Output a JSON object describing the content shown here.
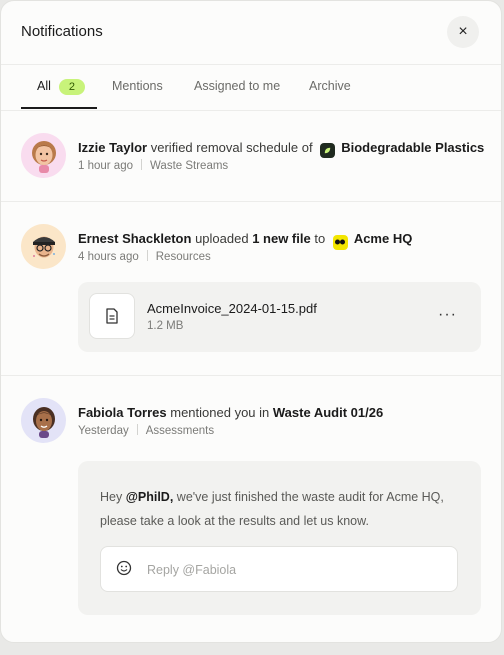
{
  "header": {
    "title": "Notifications",
    "close_label": "×"
  },
  "tabs": [
    {
      "label": "All",
      "badge": "2",
      "active": true
    },
    {
      "label": "Mentions"
    },
    {
      "label": "Assigned to me"
    },
    {
      "label": "Archive"
    }
  ],
  "notifications": [
    {
      "actor": "Izzie Taylor",
      "action": "verified removal schedule of",
      "target": "Biodegradable Plastics",
      "time": "1 hour ago",
      "category": "Waste Streams",
      "avatar_icon": "memoji-avatar-icon",
      "target_icon": "leaf-logo-icon"
    },
    {
      "actor": "Ernest Shackleton",
      "action_pre": "uploaded",
      "count": "1 new file",
      "action_post": "to",
      "target": "Acme HQ",
      "time": "4 hours ago",
      "category": "Resources",
      "avatar_icon": "memoji-avatar-icon",
      "target_icon": "acme-logo-icon",
      "file": {
        "name": "AcmeInvoice_2024-01-15.pdf",
        "size": "1.2 MB",
        "more_label": "···"
      }
    },
    {
      "actor": "Fabiola Torres",
      "action": "mentioned you in",
      "target": "Waste Audit 01/26",
      "time": "Yesterday",
      "category": "Assessments",
      "avatar_icon": "memoji-avatar-icon",
      "comment": {
        "pre": "Hey ",
        "mention": "@PhilD,",
        "body": " we've just finished the waste audit for Acme HQ, please take a look at the results and let us know."
      },
      "reply_placeholder": "Reply @Fabiola"
    }
  ],
  "colors": {
    "badge_bg": "#c8f37a",
    "accent_lime": "#c8f37a",
    "panel_bg": "#fcfcfb"
  }
}
